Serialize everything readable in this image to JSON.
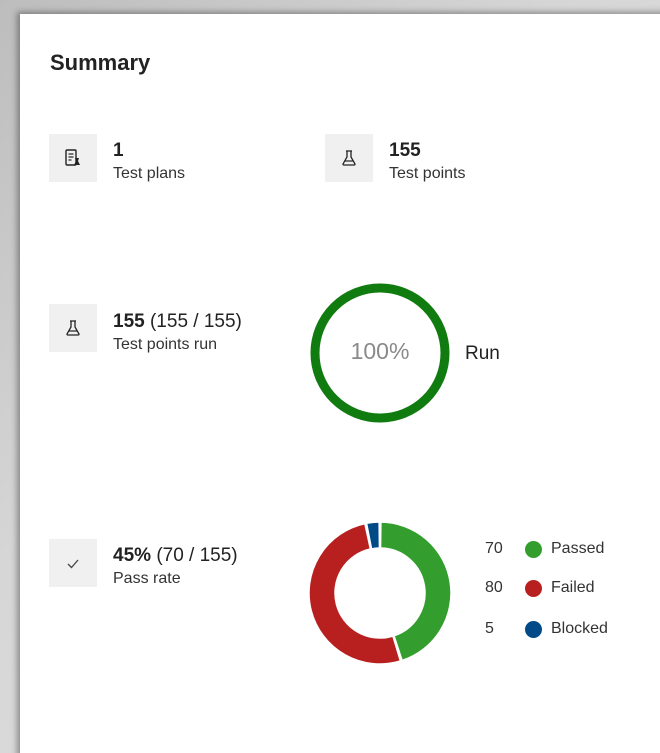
{
  "summary": {
    "title": "Summary",
    "test_plans": {
      "value": "1",
      "label": "Test plans",
      "icon": "test-plan-icon"
    },
    "test_points": {
      "value": "155",
      "label": "Test points",
      "icon": "flask-icon"
    },
    "test_points_run": {
      "value": "155",
      "detail": "(155 / 155)",
      "label": "Test points run",
      "icon": "flask-icon"
    },
    "run": {
      "percent_text": "100%",
      "percent": 100,
      "label": "Run",
      "color": "#107c10"
    },
    "pass_rate": {
      "value": "45%",
      "detail": "(70 / 155)",
      "label": "Pass rate",
      "icon": "checkmark-icon"
    },
    "outcomes": [
      {
        "count": "70",
        "label": "Passed",
        "value": 70,
        "color": "#339e2d"
      },
      {
        "count": "80",
        "label": "Failed",
        "value": 80,
        "color": "#b82020"
      },
      {
        "count": "5",
        "label": "Blocked",
        "value": 5,
        "color": "#004b87"
      }
    ]
  }
}
